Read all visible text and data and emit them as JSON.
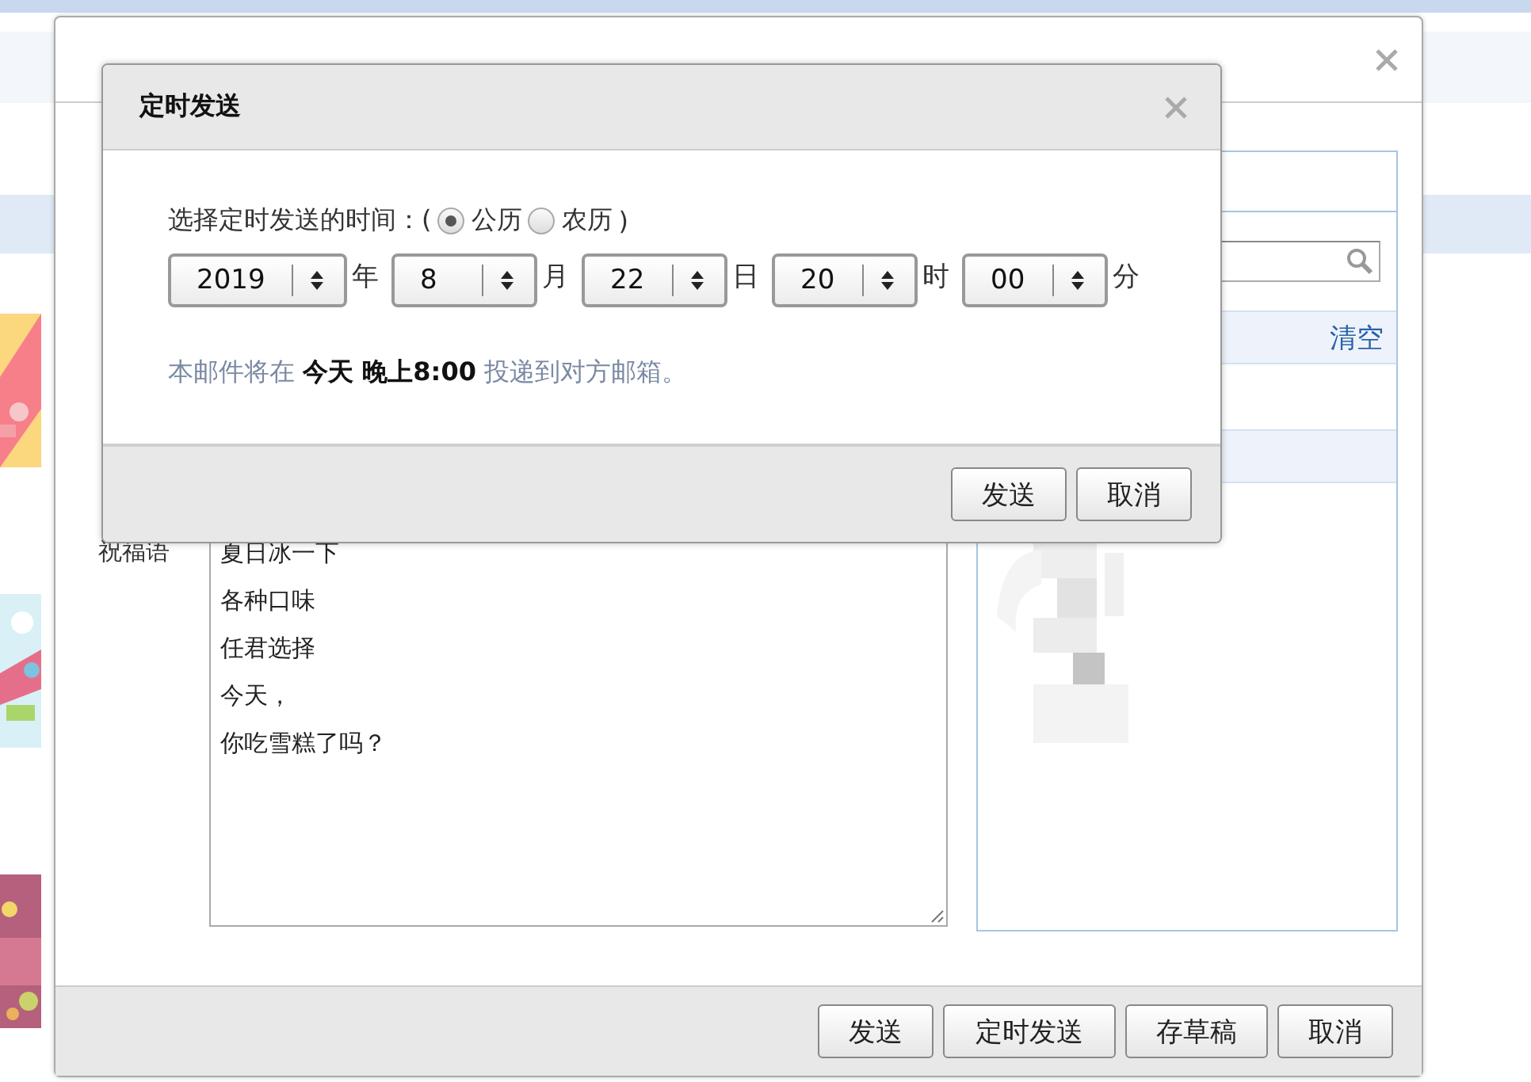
{
  "card_dialog": {
    "message_label": "祝福语",
    "message_lines": [
      "夏日冰一下",
      "各种口味",
      "任君选择",
      "今天，",
      "你吃雪糕了吗？"
    ],
    "clear_link": "清空",
    "buttons": [
      "发送",
      "定时发送",
      "存草稿",
      "取消"
    ]
  },
  "schedule_dialog": {
    "title": "定时发送",
    "prompt": "选择定时发送的时间：(",
    "calendars": [
      {
        "label": "公历",
        "selected": true
      },
      {
        "label": "农历",
        "selected": false
      }
    ],
    "prompt_end": ")",
    "fields": [
      {
        "value": "2019",
        "unit": "年"
      },
      {
        "value": "8",
        "unit": "月"
      },
      {
        "value": "22",
        "unit": "日"
      },
      {
        "value": "20",
        "unit": "时"
      },
      {
        "value": "00",
        "unit": "分"
      }
    ],
    "note": "本邮件将在 **今天 晚上8:00** 投递到对方邮箱。",
    "buttons": [
      "发送",
      "取消"
    ]
  }
}
